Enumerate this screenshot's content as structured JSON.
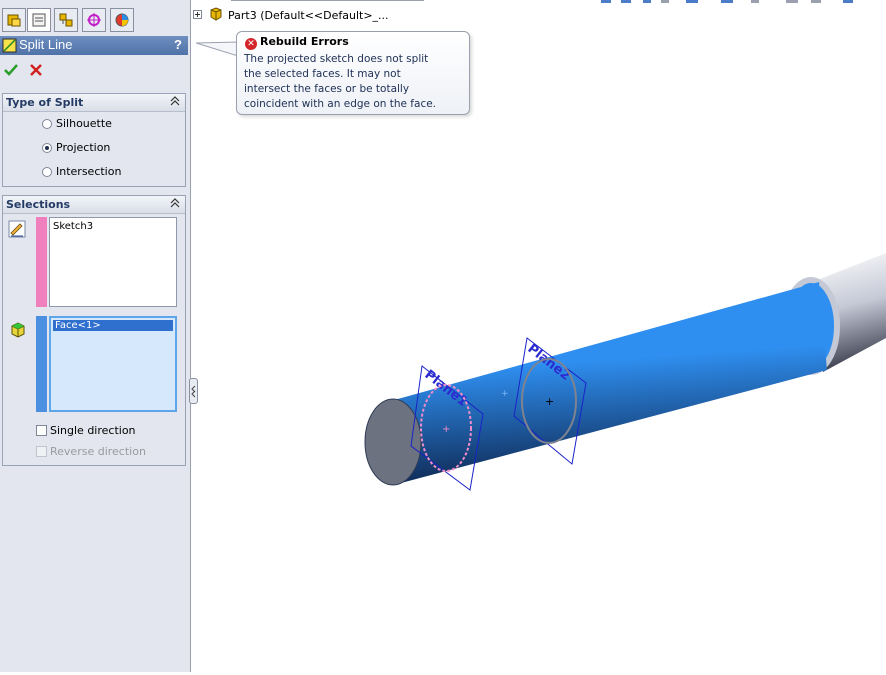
{
  "panel": {
    "title": "Split Line",
    "help": "?",
    "type_of_split": {
      "header": "Type of Split",
      "options": [
        "Silhouette",
        "Projection",
        "Intersection"
      ],
      "selected": "Projection"
    },
    "selections": {
      "header": "Selections",
      "sketch_value": "Sketch3",
      "face_value": "Face<1>",
      "single_direction_label": "Single direction",
      "reverse_direction_label": "Reverse direction"
    }
  },
  "tree": {
    "part_label": "Part3  (Default<<Default>_..."
  },
  "tooltip": {
    "title": "Rebuild Errors",
    "lines": [
      "The projected sketch does not split",
      "the selected faces.  It may not",
      "intersect the faces or be totally",
      "coincident with an edge on the face."
    ]
  },
  "viewport": {
    "plane1_label": "Plane1",
    "plane2_label": "Plane2"
  },
  "colors": {
    "cylinder_blue": "#2f8ff0",
    "plane_outline": "#1a22c9",
    "sketch_pink": "#f08cc8"
  }
}
